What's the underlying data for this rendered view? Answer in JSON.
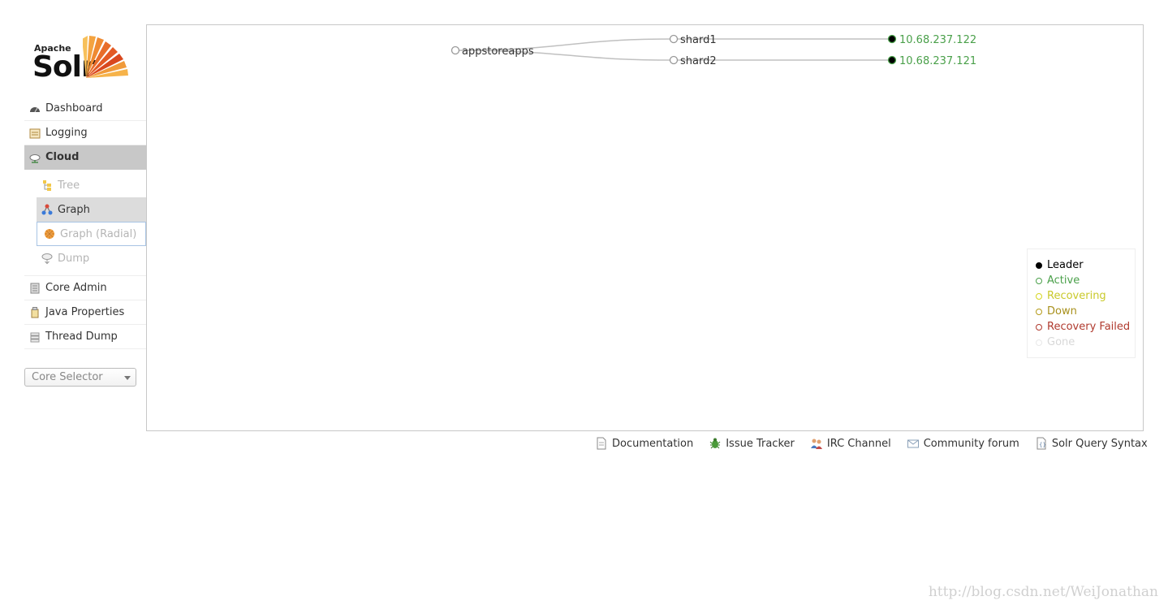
{
  "logo": {
    "apache": "Apache",
    "solr": "Solr"
  },
  "nav": {
    "dashboard": "Dashboard",
    "logging": "Logging",
    "cloud": "Cloud",
    "cloud_sub": {
      "tree": "Tree",
      "graph": "Graph",
      "graph_radial": "Graph (Radial)",
      "dump": "Dump"
    },
    "core_admin": "Core Admin",
    "java_properties": "Java Properties",
    "thread_dump": "Thread Dump"
  },
  "core_selector": {
    "placeholder": "Core Selector"
  },
  "graph": {
    "collection": "appstoreapps",
    "shards": [
      {
        "name": "shard1",
        "replica": "10.68.237.122",
        "replica_state": "leader-active"
      },
      {
        "name": "shard2",
        "replica": "10.68.237.121",
        "replica_state": "leader-active"
      }
    ]
  },
  "legend": {
    "leader": "Leader",
    "active": "Active",
    "recovering": "Recovering",
    "down": "Down",
    "recovery_failed": "Recovery Failed",
    "gone": "Gone"
  },
  "colors": {
    "leader": "#000000",
    "active": "#4aa04a",
    "recovering": "#d6d61f",
    "down": "#b59b1a",
    "recovery_failed": "#b03a2e",
    "gone": "#e8e8e8",
    "link": "#c0c0c0"
  },
  "footer": {
    "documentation": "Documentation",
    "issue_tracker": "Issue Tracker",
    "irc_channel": "IRC Channel",
    "community_forum": "Community forum",
    "query_syntax": "Solr Query Syntax"
  },
  "watermark": "http://blog.csdn.net/WeiJonathan"
}
